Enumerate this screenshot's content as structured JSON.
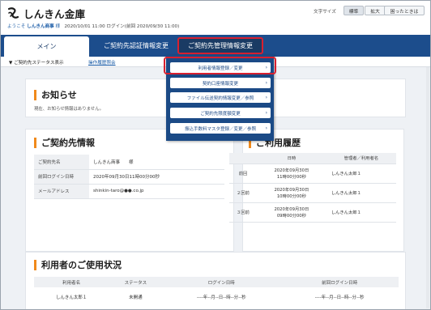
{
  "header": {
    "brand": "しんきん金庫",
    "welcome_prefix": "ようこそ",
    "welcome_name": "しんきん商事",
    "welcome_suffix": "様",
    "login_info": "2020/10/01 11:00 ログイン(前回 2020/09/30 11:00)",
    "fontsize_label": "文字サイズ",
    "btn_standard": "標準",
    "btn_large": "拡大",
    "btn_help": "困ったときは"
  },
  "nav": {
    "tabs": [
      {
        "label": "メイン"
      },
      {
        "label": "ご契約先認証情報変更"
      },
      {
        "label": "ご契約先管理情報変更"
      }
    ]
  },
  "subbar": {
    "status": "▼ ご契約先ステータス表示",
    "history": "操作履歴照会"
  },
  "dropdown": {
    "items": [
      {
        "label": "利用者情報登録／変更"
      },
      {
        "label": "契約口座情報変更"
      },
      {
        "label": "ファイル伝送契約情報変更／参照"
      },
      {
        "label": "ご契約先限度額変更"
      },
      {
        "label": "振込手数料マスタ登録／変更／参照"
      }
    ],
    "chevron": "›"
  },
  "notice": {
    "title": "お知らせ",
    "text": "現在、お知らせ情報はありません。"
  },
  "contract": {
    "title": "ご契約先情報",
    "rows": [
      {
        "key": "ご契約先名",
        "value": "しんきん商事　　様"
      },
      {
        "key": "前回ログイン日時",
        "value": "2020年09月30日11時00分00秒"
      },
      {
        "key": "メールアドレス",
        "value": "shinkin-taro@●●.co.jp"
      }
    ]
  },
  "usage": {
    "title": "ご利用履歴",
    "headers": [
      "",
      "日時",
      "管理者／利用者名"
    ],
    "rows": [
      {
        "label": "前回",
        "date": "2020年09月30日",
        "time": "11時00分00秒",
        "user": "しんきん太郎１"
      },
      {
        "label": "２回前",
        "date": "2020年09月30日",
        "time": "10時00分00秒",
        "user": "しんきん太郎１"
      },
      {
        "label": "３回前",
        "date": "2020年09月30日",
        "time": "09時00分00秒",
        "user": "しんきん太郎１"
      }
    ]
  },
  "users": {
    "title": "利用者のご使用状況",
    "headers": [
      "利用者名",
      "ステータス",
      "ログイン日時",
      "前回ログイン日時"
    ],
    "rows": [
      {
        "name": "しんきん太郎１",
        "status": "未開通",
        "login": "----年--月--日--時--分--秒",
        "prev": "----年--月--日--時--分--秒"
      }
    ]
  },
  "colors": {
    "nav_bg": "#1c4d8c",
    "accent_orange": "#f08a1c",
    "highlight_red": "#d82030",
    "link_blue": "#1e5ea8"
  }
}
